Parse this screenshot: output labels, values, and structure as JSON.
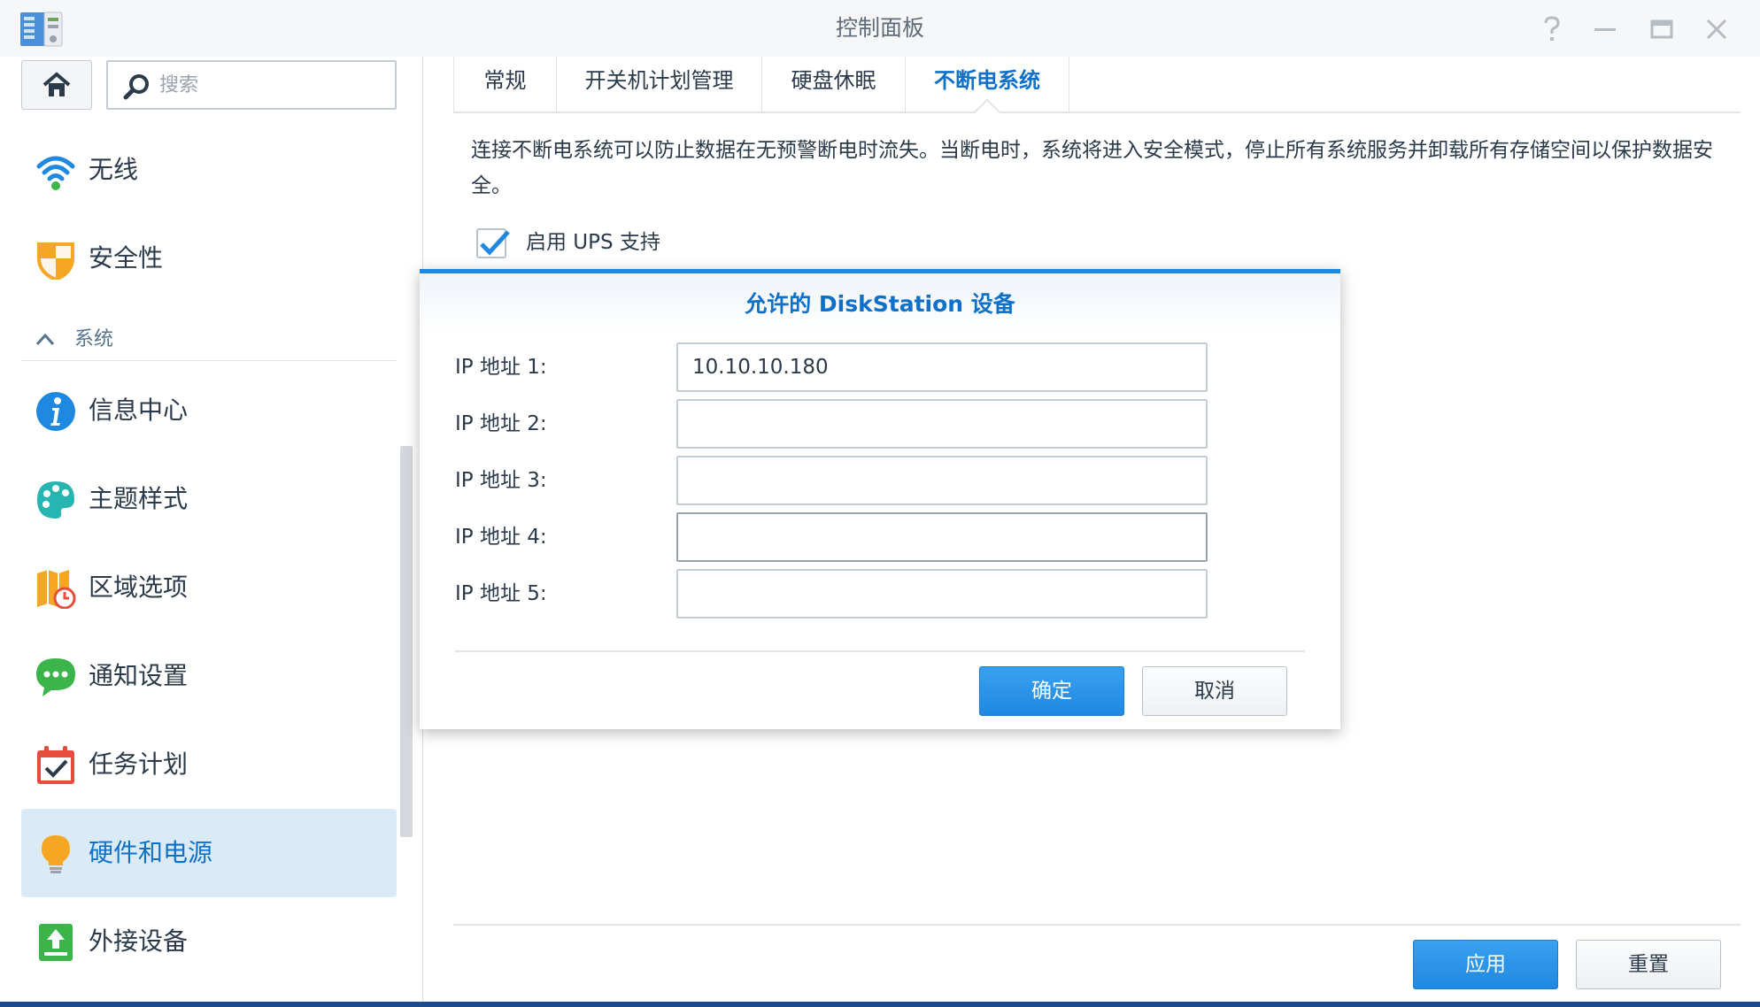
{
  "window": {
    "title": "控制面板"
  },
  "sidebar": {
    "search_placeholder": "搜索",
    "items": [
      {
        "label": "无线",
        "icon": "wifi-icon"
      },
      {
        "label": "安全性",
        "icon": "shield-icon"
      },
      {
        "label": "信息中心",
        "icon": "info-icon"
      },
      {
        "label": "主题样式",
        "icon": "palette-icon"
      },
      {
        "label": "区域选项",
        "icon": "map-clock-icon"
      },
      {
        "label": "通知设置",
        "icon": "chat-bubble-icon"
      },
      {
        "label": "任务计划",
        "icon": "calendar-check-icon"
      },
      {
        "label": "硬件和电源",
        "icon": "lightbulb-icon",
        "active": true
      },
      {
        "label": "外接设备",
        "icon": "upload-drive-icon"
      }
    ],
    "section": "系统"
  },
  "tabs": [
    {
      "label": "常规"
    },
    {
      "label": "开关机计划管理"
    },
    {
      "label": "硬盘休眠"
    },
    {
      "label": "不断电系统",
      "active": true
    }
  ],
  "ups": {
    "description": "连接不断电系统可以防止数据在无预警断电时流失。当断电时，系统将进入安全模式，停止所有系统服务并卸载所有存储空间以保护数据安全。",
    "enable_label": "启用 UPS 支持",
    "enabled": true
  },
  "footer": {
    "apply_label": "应用",
    "reset_label": "重置"
  },
  "dialog": {
    "title": "允许的 DiskStation 设备",
    "rows": [
      {
        "label": "IP 地址 1:",
        "value": "10.10.10.180"
      },
      {
        "label": "IP 地址 2:",
        "value": ""
      },
      {
        "label": "IP 地址 3:",
        "value": ""
      },
      {
        "label": "IP 地址 4:",
        "value": ""
      },
      {
        "label": "IP 地址 5:",
        "value": ""
      }
    ],
    "ok_label": "确定",
    "cancel_label": "取消"
  },
  "colors": {
    "accent": "#1f88e0",
    "active_text": "#0f70c9",
    "active_bg": "#dbeaf7"
  }
}
